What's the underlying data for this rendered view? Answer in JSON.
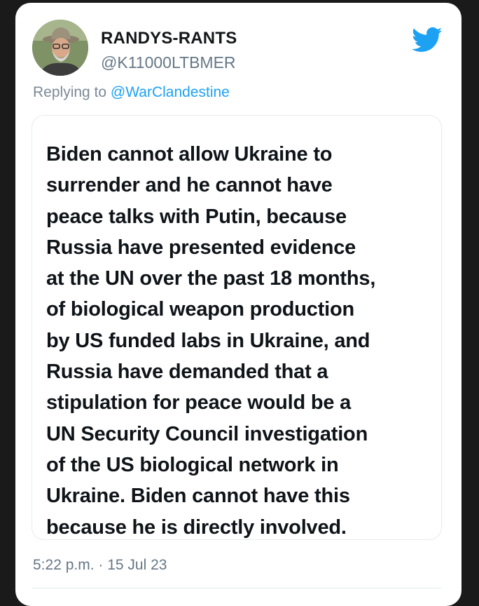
{
  "tweet": {
    "display_name": "RANDYS-RANTS",
    "handle": "@K11000LTBMER",
    "replying_prefix": "Replying to ",
    "replying_to": "@WarClandestine",
    "text": "Biden cannot allow Ukraine to\nsurrender and he cannot have\npeace talks with Putin, because\nRussia have presented evidence\nat the UN over the past 18 months,\nof biological weapon production\nby US funded labs in Ukraine, and\nRussia have demanded that a\nstipulation for peace would be a\nUN Security Council investigation\nof the US biological network in\nUkraine. Biden cannot have this\nbecause he is directly involved.",
    "timestamp": "5:22 p.m. · 15 Jul 23"
  },
  "icons": {
    "brand": "twitter-bird-icon",
    "avatar": "user-avatar"
  },
  "colors": {
    "brand_blue": "#1da1f2",
    "text_primary": "#0f1419",
    "text_secondary": "#657786"
  }
}
